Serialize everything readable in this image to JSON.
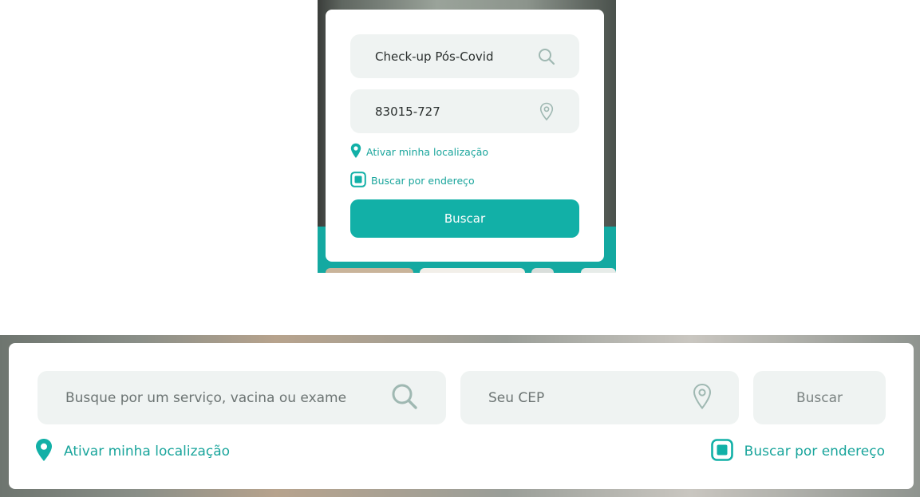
{
  "mobile": {
    "search_value": "Check-up Pós-Covid",
    "cep_value": "83015-727",
    "location_link": "Ativar minha localização",
    "address_option": "Buscar por endereço",
    "submit_label": "Buscar"
  },
  "desktop": {
    "search_placeholder": "Busque por um serviço, vacina ou exame",
    "cep_placeholder": "Seu CEP",
    "submit_label": "Buscar",
    "location_link": "Ativar minha localização",
    "address_option": "Buscar por endereço"
  },
  "colors": {
    "accent": "#12b0a7",
    "link": "#1aa59c",
    "field_bg": "#eff3f2",
    "icon_muted": "#9fb8b2"
  },
  "icons": [
    "search-icon",
    "location-pin-icon",
    "filled-location-pin-icon",
    "checkbox-icon"
  ]
}
